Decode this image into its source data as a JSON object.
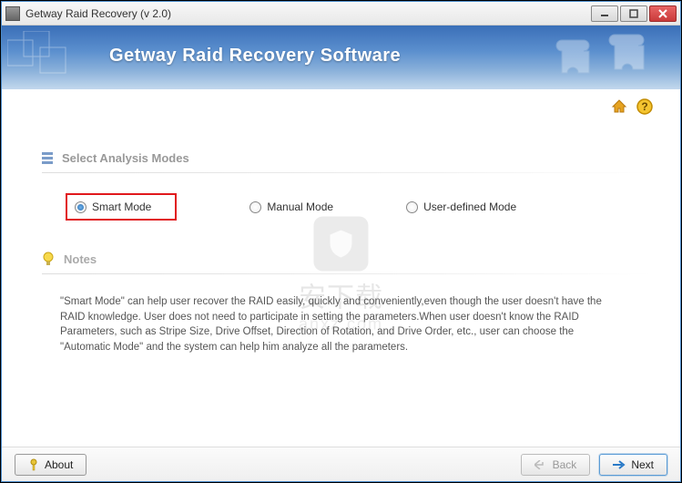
{
  "window": {
    "title": "Getway Raid Recovery (v 2.0)"
  },
  "header": {
    "title": "Getway Raid Recovery Software"
  },
  "sections": {
    "analysis_heading": "Select Analysis Modes",
    "notes_heading": "Notes"
  },
  "modes": {
    "smart": "Smart Mode",
    "manual": "Manual Mode",
    "user_defined": "User-defined Mode",
    "selected": "smart"
  },
  "notes": {
    "text": "\"Smart Mode\" can help user recover the RAID easily, quickly and conveniently,even though the user doesn't have the RAID knowledge. User does not need to participate in setting the parameters.When user doesn't know the RAID Parameters, such as Stripe Size, Drive Offset, Direction of Rotation, and Drive Order,  etc., user can choose the \"Automatic Mode\" and the system can help him analyze all the parameters."
  },
  "footer": {
    "about": "About",
    "back": "Back",
    "next": "Next"
  },
  "watermark": {
    "text": "安下载",
    "sub": "anxz.com"
  }
}
